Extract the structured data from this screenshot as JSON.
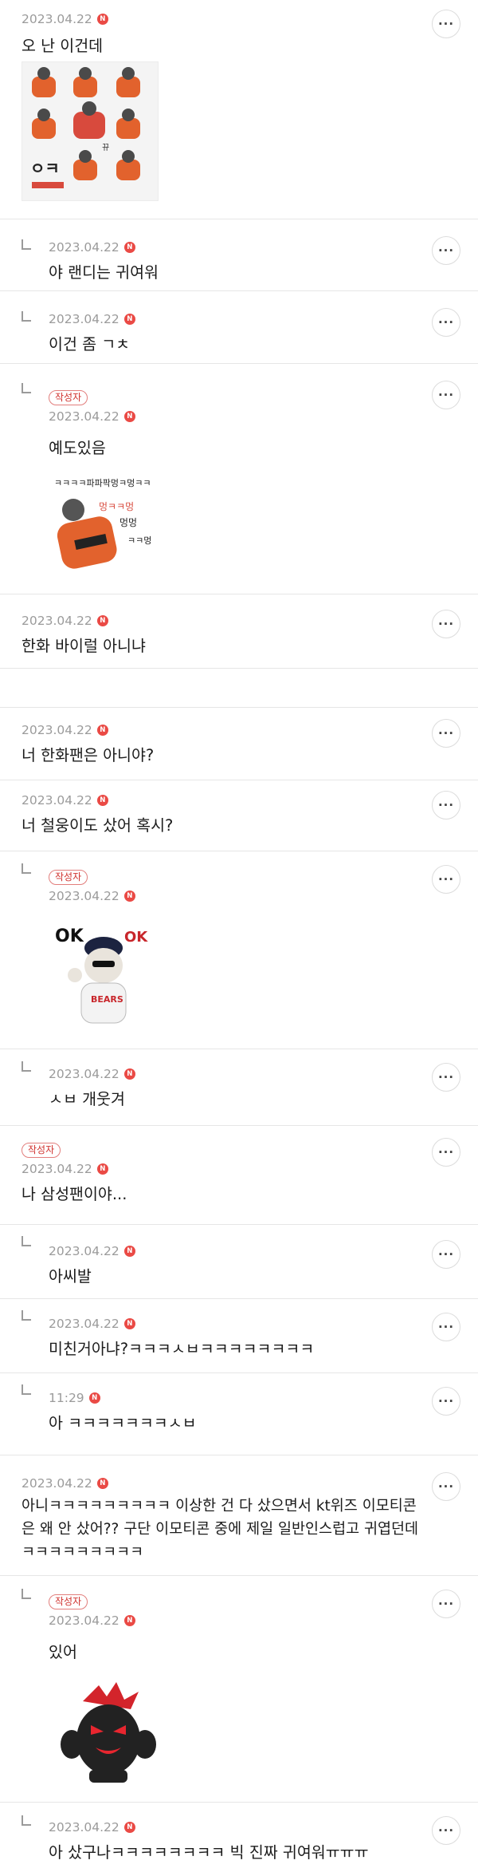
{
  "comments": [
    {
      "date": "2023.04.22",
      "text": "오 난 이건데",
      "author_badge": ""
    },
    {
      "date": "2023.04.22",
      "text": "야 랜디는 귀여워",
      "author_badge": ""
    },
    {
      "date": "2023.04.22",
      "text": "이건 좀 ㄱㅊ",
      "author_badge": ""
    },
    {
      "date": "2023.04.22",
      "text": "예도있음",
      "author_badge": "작성자"
    },
    {
      "date": "2023.04.22",
      "text": "한화 바이럴 아니냐",
      "author_badge": ""
    },
    {
      "date": "2023.04.22",
      "text": "너 한화팬은 아니야?",
      "author_badge": ""
    },
    {
      "date": "2023.04.22",
      "text": "너 철웅이도 샀어 혹시?",
      "author_badge": ""
    },
    {
      "date": "2023.04.22",
      "text": "",
      "author_badge": "작성자"
    },
    {
      "date": "2023.04.22",
      "text": "ㅅㅂ 개웃겨",
      "author_badge": ""
    },
    {
      "date": "2023.04.22",
      "text": "나 삼성팬이야...",
      "author_badge": "작성자"
    },
    {
      "date": "2023.04.22",
      "text": "아씨발",
      "author_badge": ""
    },
    {
      "date": "2023.04.22",
      "text": "미친거아냐?ㅋㅋㅋㅅㅂㅋㅋㅋㅋㅋㅋㅋㅋ",
      "author_badge": ""
    },
    {
      "date": "11:29",
      "text": "아 ㅋㅋㅋㅋㅋㅋㅋㅅㅂ",
      "author_badge": ""
    },
    {
      "date": "2023.04.22",
      "text": "아니ㅋㅋㅋㅋㅋㅋㅋㅋㅋ 이상한 건 다 샀으면서 kt위즈 이모티콘\n은 왜 안 샀어?? 구단 이모티콘 중에 제일 일반인스럽고 귀엽던데\nㅋㅋㅋㅋㅋㅋㅋㅋㅋ",
      "author_badge": ""
    },
    {
      "date": "2023.04.22",
      "text": "있어",
      "author_badge": "작성자"
    },
    {
      "date": "2023.04.22",
      "text": "아 샀구나ㅋㅋㅋㅋㅋㅋㅋㅋ 빅 진짜 귀여워ㅠㅠㅠ",
      "author_badge": ""
    }
  ],
  "new_label": "N",
  "more_glyph": "...",
  "stickers": {
    "sheet_bottom_text": "",
    "yedo_text": "ㅋㅋㅋㅋ파파팍멍ㅋ멍ㅋㅋ",
    "bears_ok_left": "OK",
    "bears_ok_right": "OK",
    "bears_jersey": "BEARS"
  },
  "colors": {
    "new_badge": "#ea4a45",
    "author_badge": "#d0312d",
    "divider": "#e6e6e6"
  }
}
